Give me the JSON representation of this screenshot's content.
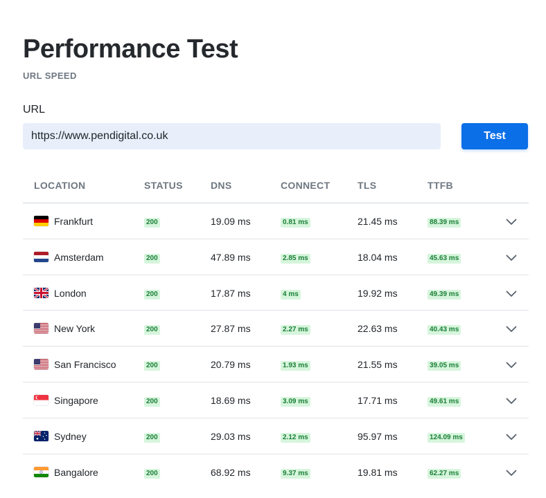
{
  "header": {
    "title": "Performance Test",
    "subtitle": "URL SPEED"
  },
  "form": {
    "url_label": "URL",
    "url_value": "https://www.pendigital.co.uk",
    "test_label": "Test"
  },
  "table": {
    "columns": [
      "LOCATION",
      "STATUS",
      "DNS",
      "CONNECT",
      "TLS",
      "TTFB"
    ],
    "rows": [
      {
        "flag": "germany-flag-icon",
        "location": "Frankfurt",
        "status": "200",
        "dns": "19.09 ms",
        "connect": "0.81 ms",
        "tls": "21.45 ms",
        "ttfb": "88.39 ms"
      },
      {
        "flag": "netherlands-flag-icon",
        "location": "Amsterdam",
        "status": "200",
        "dns": "47.89 ms",
        "connect": "2.85 ms",
        "tls": "18.04 ms",
        "ttfb": "45.63 ms"
      },
      {
        "flag": "uk-flag-icon",
        "location": "London",
        "status": "200",
        "dns": "17.87 ms",
        "connect": "4 ms",
        "tls": "19.92 ms",
        "ttfb": "49.39 ms"
      },
      {
        "flag": "usa-flag-icon",
        "location": "New York",
        "status": "200",
        "dns": "27.87 ms",
        "connect": "2.27 ms",
        "tls": "22.63 ms",
        "ttfb": "40.43 ms"
      },
      {
        "flag": "usa-flag-icon",
        "location": "San Francisco",
        "status": "200",
        "dns": "20.79 ms",
        "connect": "1.93 ms",
        "tls": "21.55 ms",
        "ttfb": "39.05 ms"
      },
      {
        "flag": "singapore-flag-icon",
        "location": "Singapore",
        "status": "200",
        "dns": "18.69 ms",
        "connect": "3.09 ms",
        "tls": "17.71 ms",
        "ttfb": "49.61 ms"
      },
      {
        "flag": "australia-flag-icon",
        "location": "Sydney",
        "status": "200",
        "dns": "29.03 ms",
        "connect": "2.12 ms",
        "tls": "95.97 ms",
        "ttfb": "124.09 ms"
      },
      {
        "flag": "india-flag-icon",
        "location": "Bangalore",
        "status": "200",
        "dns": "68.92 ms",
        "connect": "9.37 ms",
        "tls": "19.81 ms",
        "ttfb": "62.27 ms"
      }
    ]
  },
  "colors": {
    "accent": "#0b6fe8",
    "input_bg": "#e8effb",
    "badge_bg": "#d6f5dc",
    "badge_text": "#1a7f37"
  }
}
